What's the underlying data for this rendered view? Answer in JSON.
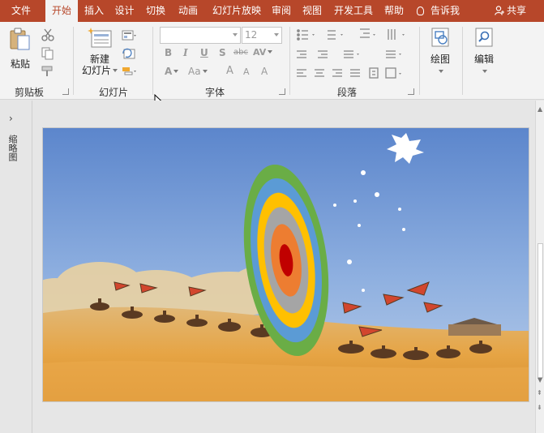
{
  "tabs": [
    {
      "label": "文件"
    },
    {
      "label": "开始",
      "active": true
    },
    {
      "label": "插入"
    },
    {
      "label": "设计"
    },
    {
      "label": "切换"
    },
    {
      "label": "动画"
    },
    {
      "label": "幻灯片放映"
    },
    {
      "label": "审阅"
    },
    {
      "label": "视图"
    },
    {
      "label": "开发工具"
    },
    {
      "label": "帮助"
    }
  ],
  "tell_me": "告诉我",
  "share": "共享",
  "ribbon": {
    "clipboard": {
      "paste_label": "粘贴",
      "group_label": "剪贴板"
    },
    "slides": {
      "new_slide_line1": "新建",
      "new_slide_line2": "幻灯片",
      "group_label": "幻灯片"
    },
    "font": {
      "font_name": "",
      "font_size": "12",
      "bold": "B",
      "italic": "I",
      "underline": "U",
      "shadow": "S",
      "strike": "abc",
      "spacing": "AV",
      "font_color": "A",
      "change_case": "Aa",
      "grow": "A",
      "shrink": "A",
      "clear": "A",
      "group_label": "字体"
    },
    "paragraph": {
      "group_label": "段落"
    },
    "drawing": {
      "label": "绘图"
    },
    "editing": {
      "label": "编辑"
    }
  },
  "left_panel": {
    "label": "缩略图"
  },
  "colors": {
    "accent": "#b7472a",
    "ribbon_bg": "#f3f3f3",
    "workspace_bg": "#e6e6e6"
  }
}
